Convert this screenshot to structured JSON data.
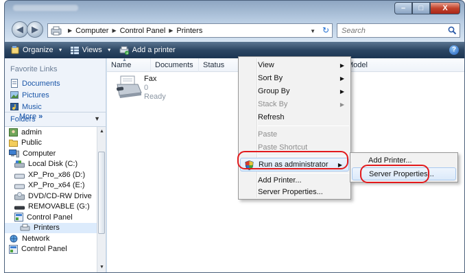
{
  "window": {
    "caption_buttons": {
      "minimize": "–",
      "maximize": "□",
      "close": "X"
    }
  },
  "navigation": {
    "back": "◀",
    "forward": "▶"
  },
  "address": {
    "crumbs": [
      "Computer",
      "Control Panel",
      "Printers"
    ],
    "separator": "▶",
    "dropdown": "▼",
    "refresh": "↻"
  },
  "search": {
    "placeholder": "Search"
  },
  "toolbar": {
    "organize": "Organize",
    "views": "Views",
    "add_printer": "Add a printer",
    "help": "?"
  },
  "sidebar": {
    "favorites_header": "Favorite Links",
    "favorites": [
      {
        "label": "Documents",
        "icon": "documents-icon"
      },
      {
        "label": "Pictures",
        "icon": "pictures-icon"
      },
      {
        "label": "Music",
        "icon": "music-icon"
      }
    ],
    "more": "More",
    "more_glyph": "»",
    "folders_header": "Folders",
    "tree": [
      {
        "label": "admin",
        "indent": 0,
        "icon": "user-folder-icon"
      },
      {
        "label": "Public",
        "indent": 0,
        "icon": "folder-icon"
      },
      {
        "label": "Computer",
        "indent": 0,
        "icon": "computer-icon"
      },
      {
        "label": "Local Disk (C:)",
        "indent": 1,
        "icon": "local-disk-icon"
      },
      {
        "label": "XP_Pro_x86 (D:)",
        "indent": 1,
        "icon": "drive-icon"
      },
      {
        "label": "XP_Pro_x64 (E:)",
        "indent": 1,
        "icon": "drive-icon"
      },
      {
        "label": "DVD/CD-RW Drive",
        "indent": 1,
        "icon": "dvd-drive-icon"
      },
      {
        "label": "REMOVABLE (G:)",
        "indent": 1,
        "icon": "removable-drive-icon"
      },
      {
        "label": "Control Panel",
        "indent": 1,
        "icon": "control-panel-icon"
      },
      {
        "label": "Printers",
        "indent": 2,
        "icon": "printers-icon",
        "selected": true
      },
      {
        "label": "Network",
        "indent": 0,
        "icon": "network-icon"
      },
      {
        "label": "Control Panel",
        "indent": 0,
        "icon": "control-panel-icon"
      }
    ]
  },
  "columns": [
    "Name",
    "Documents",
    "Status",
    "Model"
  ],
  "items": [
    {
      "name": "Fax",
      "documents": "0",
      "status": "Ready"
    }
  ],
  "context_menu": {
    "items": [
      {
        "label": "View",
        "submenu": true,
        "disabled": false
      },
      {
        "label": "Sort By",
        "submenu": true,
        "disabled": false
      },
      {
        "label": "Group By",
        "submenu": true,
        "disabled": false
      },
      {
        "label": "Stack By",
        "submenu": true,
        "disabled": true
      },
      {
        "label": "Refresh",
        "submenu": false,
        "disabled": false
      },
      {
        "label": "Paste",
        "submenu": false,
        "disabled": true
      },
      {
        "label": "Paste Shortcut",
        "submenu": false,
        "disabled": true
      },
      {
        "label": "Run as administrator",
        "submenu": true,
        "disabled": false,
        "highlighted": true
      },
      {
        "label": "Add Printer...",
        "submenu": false,
        "disabled": false
      },
      {
        "label": "Server Properties...",
        "submenu": false,
        "disabled": false
      }
    ],
    "submenu_glyph": "▶"
  },
  "submenu": {
    "items": [
      {
        "label": "Add Printer..."
      },
      {
        "label": "Server Properties...",
        "highlighted": true
      }
    ]
  },
  "colors": {
    "toolbar_top": "#5b7591",
    "toolbar_bottom": "#1c3552",
    "link_blue": "#1a56a8",
    "highlight_red": "#e2191c",
    "menu_bg": "#f2f2f2"
  }
}
